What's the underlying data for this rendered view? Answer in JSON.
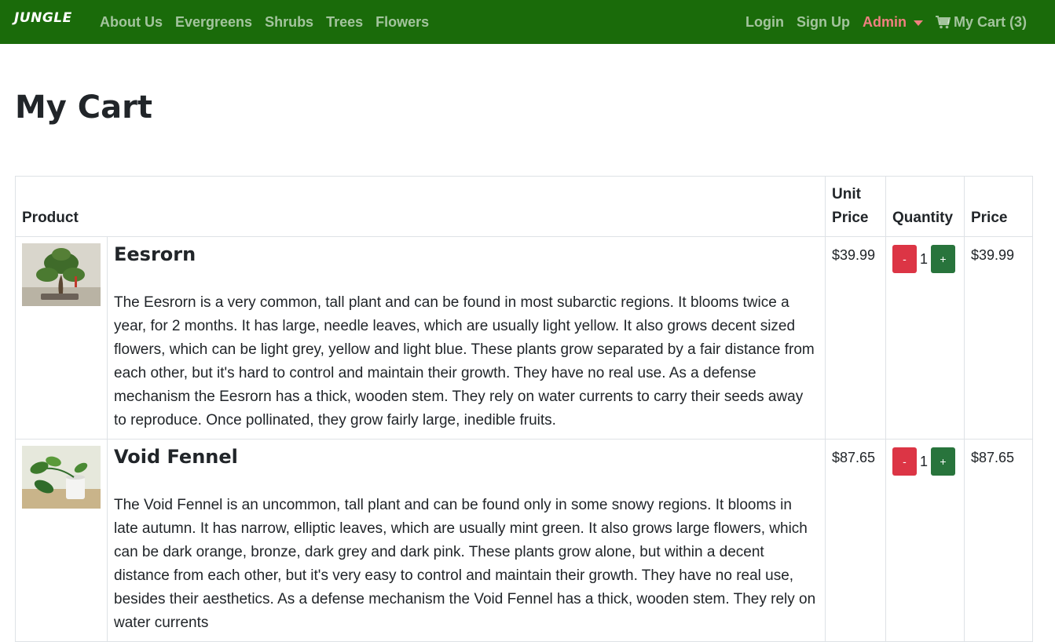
{
  "nav": {
    "brand": "JUNGLE",
    "left_links": [
      "About Us",
      "Evergreens",
      "Shrubs",
      "Trees",
      "Flowers"
    ],
    "login": "Login",
    "signup": "Sign Up",
    "admin": "Admin",
    "cart": "My Cart (3)"
  },
  "page": {
    "title": "My Cart"
  },
  "table": {
    "headers": {
      "product": "Product",
      "unit_price": "Unit Price",
      "quantity": "Quantity",
      "price": "Price"
    },
    "items": [
      {
        "name": "Eesrorn",
        "description": "The Eesrorn is a very common, tall plant and can be found in most subarctic regions. It blooms twice a year, for 2 months. It has large, needle leaves, which are usually light yellow. It also grows decent sized flowers, which can be light grey, yellow and light blue. These plants grow separated by a fair distance from each other, but it's hard to control and maintain their growth. They have no real use. As a defense mechanism the Eesrorn has a thick, wooden stem. They rely on water currents to carry their seeds away to reproduce. Once pollinated, they grow fairly large, inedible fruits.",
        "unit_price": "$39.99",
        "minus": "-",
        "quantity": "1",
        "plus": "+",
        "price": "$39.99"
      },
      {
        "name": "Void Fennel",
        "description": "The Void Fennel is an uncommon, tall plant and can be found only in some snowy regions. It blooms in late autumn. It has narrow, elliptic leaves, which are usually mint green. It also grows large flowers, which can be dark orange, bronze, dark grey and dark pink. These plants grow alone, but within a decent distance from each other, but it's very easy to control and maintain their growth. They have no real use, besides their aesthetics. As a defense mechanism the Void Fennel has a thick, wooden stem. They rely on water currents",
        "unit_price": "$87.65",
        "minus": "-",
        "quantity": "1",
        "plus": "+",
        "price": "$87.65"
      }
    ]
  },
  "colors": {
    "navbar": "#1a6b0a",
    "admin_link": "#f08080",
    "minus_button": "#dc3545",
    "plus_button": "#28743c"
  },
  "icons": {
    "cart": "shopping-cart-icon",
    "admin_dropdown": "caret-down-icon"
  }
}
